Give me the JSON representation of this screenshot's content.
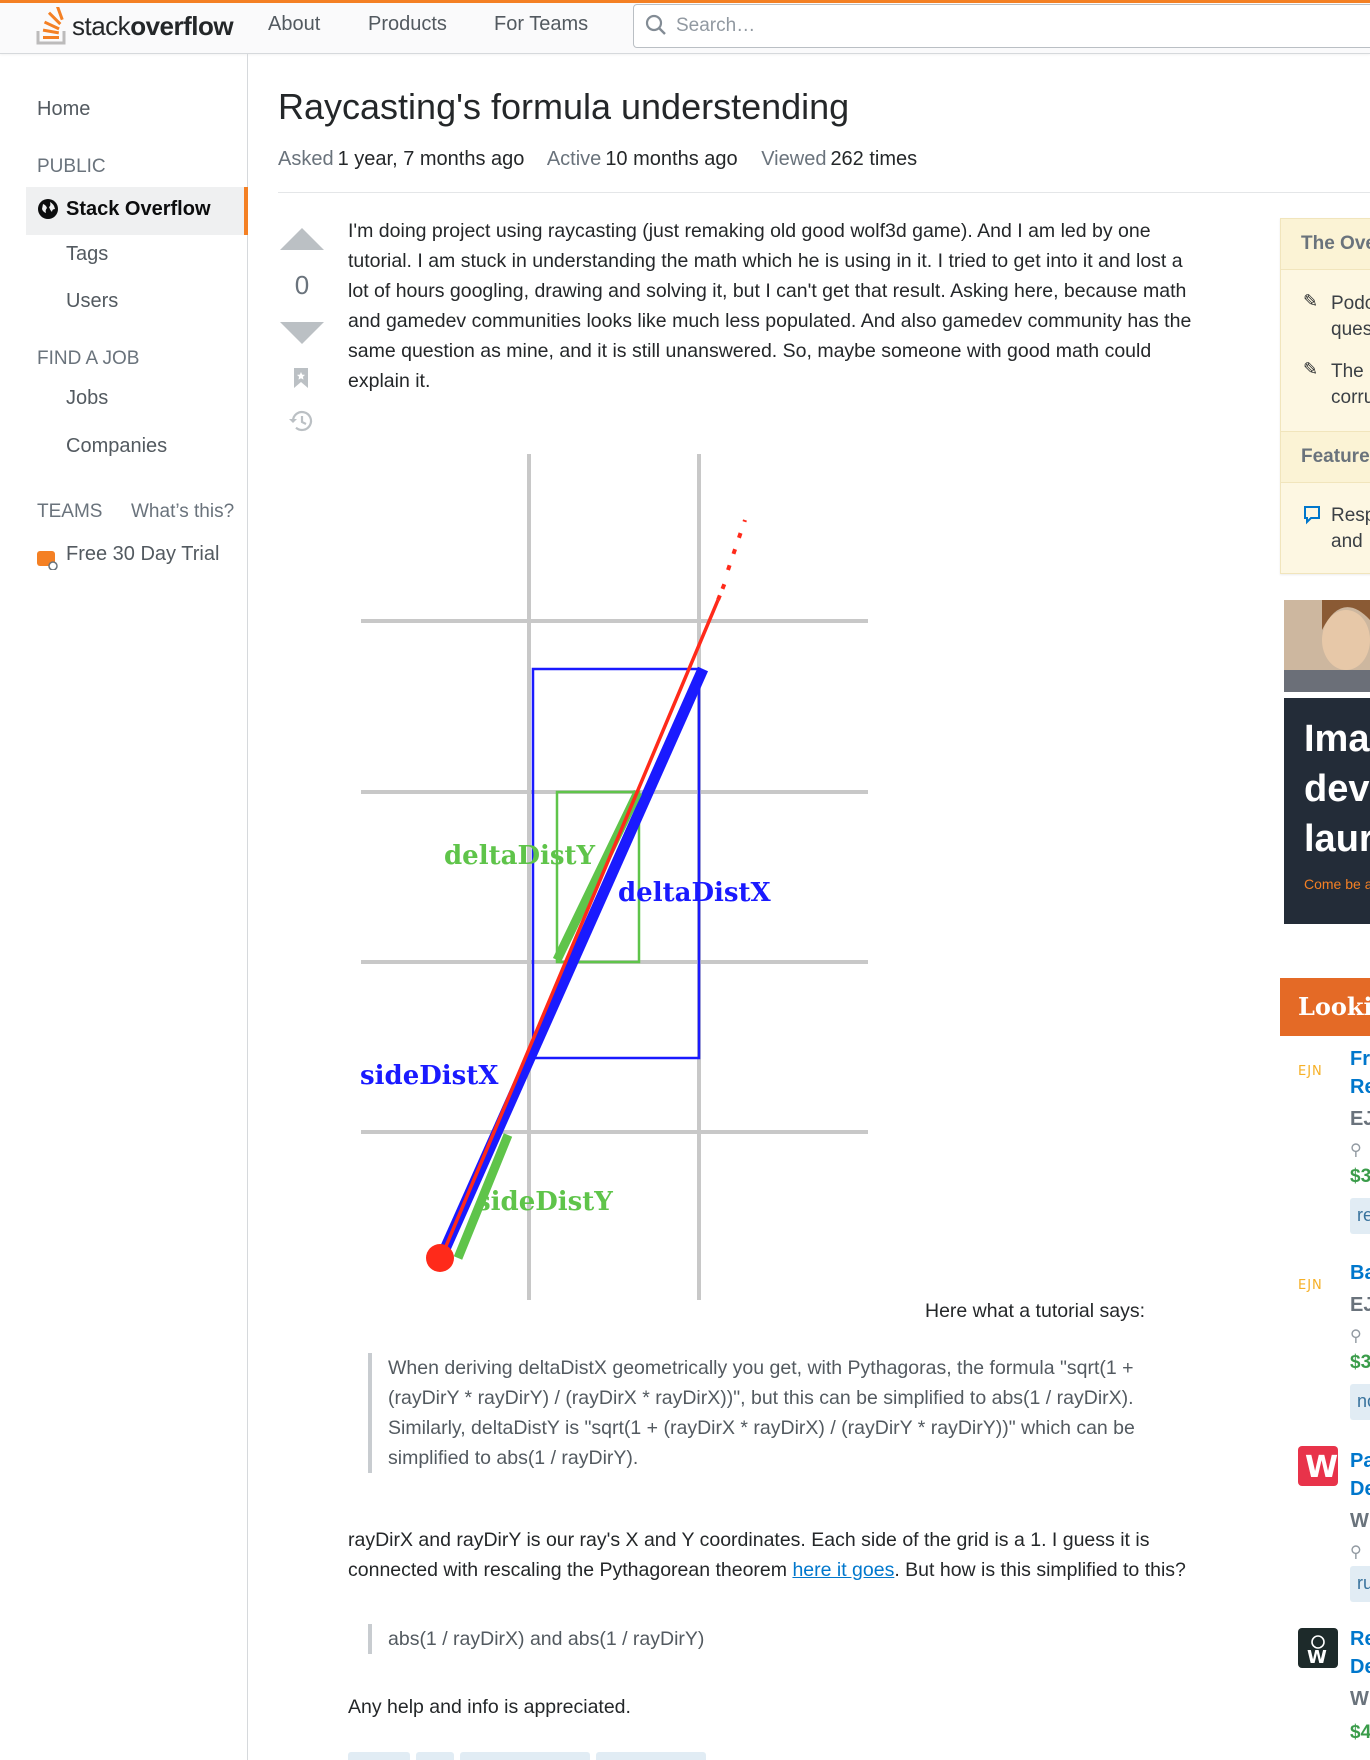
{
  "header": {
    "logo_word1": "stack",
    "logo_word2": "overflow",
    "nav": [
      "About",
      "Products",
      "For Teams"
    ],
    "search_placeholder": "Search…"
  },
  "sidebar": {
    "home": "Home",
    "public_heading": "PUBLIC",
    "stack_overflow": "Stack Overflow",
    "tags": "Tags",
    "users": "Users",
    "find_job_heading": "FIND A JOB",
    "jobs": "Jobs",
    "companies": "Companies",
    "teams_heading": "TEAMS",
    "whats_this": "What’s this?",
    "trial": "Free 30 Day Trial"
  },
  "question": {
    "title": "Raycasting's formula understending",
    "asked_label": "Asked",
    "asked_value": "1 year, 7 months ago",
    "active_label": "Active",
    "active_value": "10 months ago",
    "viewed_label": "Viewed",
    "viewed_value": "262 times",
    "votes": "0",
    "body_lines": [
      "I'm doing project using raycasting (just remaking old good wolf3d game). And I am led by one",
      "tutorial. I am stuck in understanding the math which he is using in it. I tried to get into it and lost a",
      "lot of hours googling, drawing and solving it, but I can't get that result. Asking here, because math",
      "and gamedev communities looks like much less populated. And also gamedev community has the",
      "same question as mine, and it is still unanswered. So, maybe someone with good math could",
      "explain it."
    ],
    "figure_labels": {
      "delta_y": "deltaDistY",
      "delta_x": "deltaDistX",
      "side_x": "sideDistX",
      "side_y": "sideDistY"
    },
    "caption": "Here what a tutorial says:",
    "quote_lines": [
      "When deriving deltaDistX geometrically you get, with Pythagoras, the formula \"sqrt(1 +",
      "(rayDirY * rayDirY) / (rayDirX * rayDirX))\", but this can be simplified to abs(1 / rayDirX).",
      "Similarly, deltaDistY is \"sqrt(1 + (rayDirX * rayDirX) / (rayDirY * rayDirY))\" which can be",
      "simplified to abs(1 / rayDirY)."
    ],
    "para2_line1": "rayDirX and rayDirY is our ray's X and Y coordinates. Each side of the grid is a 1. I guess it is",
    "para2_line2_before": "connected with rescaling the Pythagorean theorem ",
    "para2_link": "here it goes",
    "para2_line2_after": ". But how is this simplified to this?",
    "quote2": "abs(1 / rayDirX) and abs(1 / rayDirY)",
    "closing": "Any help and info is appreciated."
  },
  "right_sidebar": {
    "overflow_blog_head": "The Ove",
    "ob_item1_l1": "Podc",
    "ob_item1_l2": "ques",
    "ob_item2_l1": "The",
    "ob_item2_l2": "corru",
    "featured_head": "Feature",
    "feat_item_l1": "Resp",
    "feat_item_l2": "and",
    "ad_lines": [
      "Ima",
      "dev",
      "laur"
    ],
    "ad_small": "Come be a",
    "jobs_head": "Lookin",
    "jobs": [
      {
        "title_l1": "Fr",
        "title_l2": "Re",
        "company": "EJ",
        "salary": "$3",
        "tag": "re",
        "logo": "EJN"
      },
      {
        "title_l1": "Ba",
        "company": "EJ",
        "salary": "$3",
        "tag": "no",
        "logo": "EJN"
      },
      {
        "title_l1": "Pa",
        "title_l2": "De",
        "company": "W",
        "tag": "ru",
        "logo": "W"
      },
      {
        "title_l1": "Re",
        "title_l2": "De",
        "company": "W",
        "salary": "$4",
        "logo": "W"
      }
    ]
  },
  "colors": {
    "accent": "#f48024",
    "link": "#0077cc",
    "ray_red": "#ff2a1a",
    "ray_blue": "#1a1aff",
    "ray_green": "#5fc44a"
  }
}
